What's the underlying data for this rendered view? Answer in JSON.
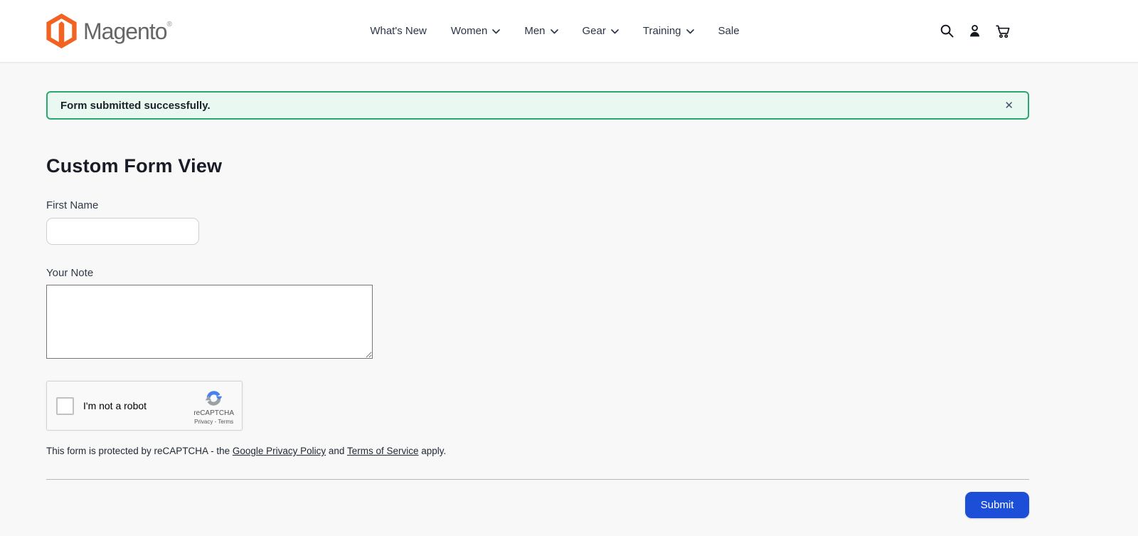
{
  "header": {
    "brand": "Magento",
    "brand_reg": "®",
    "nav": [
      {
        "label": "What's New",
        "has_dropdown": false
      },
      {
        "label": "Women",
        "has_dropdown": true
      },
      {
        "label": "Men",
        "has_dropdown": true
      },
      {
        "label": "Gear",
        "has_dropdown": true
      },
      {
        "label": "Training",
        "has_dropdown": true
      },
      {
        "label": "Sale",
        "has_dropdown": false
      }
    ],
    "icons": [
      "search-icon",
      "account-icon",
      "cart-icon"
    ]
  },
  "banner": {
    "message": "Form submitted successfully.",
    "close_label": "✕"
  },
  "form": {
    "title": "Custom Form View",
    "first_name": {
      "label": "First Name",
      "value": ""
    },
    "note": {
      "label": "Your Note",
      "value": ""
    },
    "recaptcha": {
      "checkbox_label": "I'm not a robot",
      "brand": "reCAPTCHA",
      "privacy": "Privacy",
      "separator": "-",
      "terms": "Terms"
    },
    "disclaimer": {
      "prefix": "This form is protected by reCAPTCHA - the ",
      "privacy_link": "Google Privacy Policy",
      "middle": " and ",
      "terms_link": "Terms of Service",
      "suffix": " apply."
    },
    "submit_label": "Submit"
  },
  "colors": {
    "brand_orange": "#f26322",
    "success_border": "#2aa86f",
    "success_bg": "#e9f8f0",
    "submit_blue": "#1d4ed8",
    "recaptcha_blue": "#4a7ff0",
    "recaptcha_gray": "#9aa0a6"
  }
}
